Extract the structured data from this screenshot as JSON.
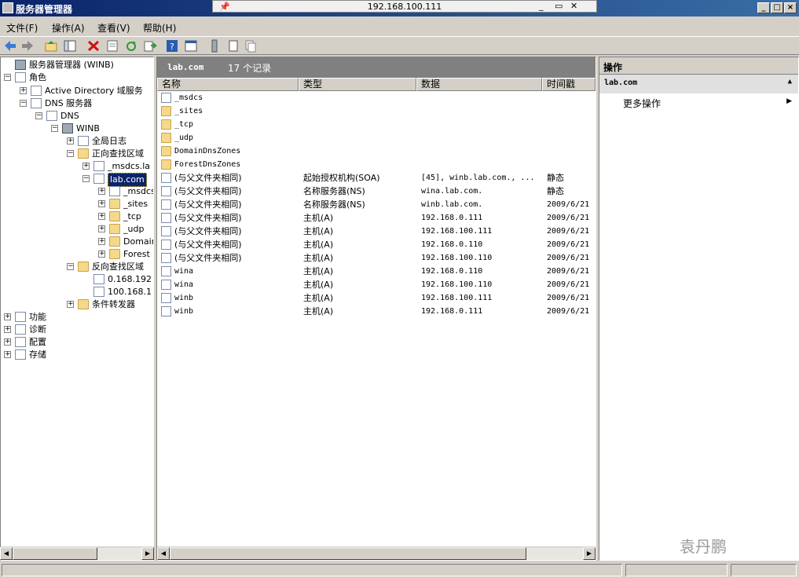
{
  "window": {
    "title": "服务器管理器",
    "rdp_ip": "192.168.100.111",
    "rdp_controls": "_ ▭ ✕"
  },
  "menu": [
    "文件(F)",
    "操作(A)",
    "查看(V)",
    "帮助(H)"
  ],
  "tree": [
    {
      "label": "服务器管理器 (WINB)",
      "depth": 0,
      "exp": "",
      "icon": "server-manager-icon"
    },
    {
      "label": "角色",
      "depth": 0,
      "exp": "−",
      "icon": "roles-icon"
    },
    {
      "label": "Active Directory 域服务",
      "depth": 1,
      "exp": "+",
      "icon": "ad-icon"
    },
    {
      "label": "DNS 服务器",
      "depth": 1,
      "exp": "−",
      "icon": "dns-server-icon"
    },
    {
      "label": "DNS",
      "depth": 2,
      "exp": "−",
      "icon": "dns-icon"
    },
    {
      "label": "WINB",
      "depth": 3,
      "exp": "−",
      "icon": "server-icon"
    },
    {
      "label": "全局日志",
      "depth": 4,
      "exp": "+",
      "icon": "log-icon"
    },
    {
      "label": "正向查找区域",
      "depth": 4,
      "exp": "−",
      "icon": "folder-icon"
    },
    {
      "label": "_msdcs.la",
      "depth": 5,
      "exp": "+",
      "icon": "zone-icon"
    },
    {
      "label": "lab.com",
      "depth": 5,
      "exp": "−",
      "icon": "zone-icon",
      "selected": true
    },
    {
      "label": "_msdcs",
      "depth": 6,
      "exp": "+",
      "icon": "zone-icon"
    },
    {
      "label": "_sites",
      "depth": 6,
      "exp": "+",
      "icon": "folder-icon"
    },
    {
      "label": "_tcp",
      "depth": 6,
      "exp": "+",
      "icon": "folder-icon"
    },
    {
      "label": "_udp",
      "depth": 6,
      "exp": "+",
      "icon": "folder-icon"
    },
    {
      "label": "Domain",
      "depth": 6,
      "exp": "+",
      "icon": "folder-icon"
    },
    {
      "label": "Forest",
      "depth": 6,
      "exp": "+",
      "icon": "folder-icon"
    },
    {
      "label": "反向查找区域",
      "depth": 4,
      "exp": "−",
      "icon": "folder-icon"
    },
    {
      "label": "0.168.192",
      "depth": 5,
      "exp": "",
      "icon": "zone-icon"
    },
    {
      "label": "100.168.1",
      "depth": 5,
      "exp": "",
      "icon": "zone-icon"
    },
    {
      "label": "条件转发器",
      "depth": 4,
      "exp": "+",
      "icon": "folder-icon"
    },
    {
      "label": "功能",
      "depth": 0,
      "exp": "+",
      "icon": "features-icon"
    },
    {
      "label": "诊断",
      "depth": 0,
      "exp": "+",
      "icon": "diagnostics-icon"
    },
    {
      "label": "配置",
      "depth": 0,
      "exp": "+",
      "icon": "configuration-icon"
    },
    {
      "label": "存储",
      "depth": 0,
      "exp": "+",
      "icon": "storage-icon"
    }
  ],
  "list": {
    "title": "lab.com",
    "count": "17 个记录",
    "columns": [
      "名称",
      "类型",
      "数据",
      "时间戳"
    ],
    "rows": [
      {
        "name": "_msdcs",
        "type": "",
        "data": "",
        "ts": "",
        "icon": "zone-icon"
      },
      {
        "name": "_sites",
        "type": "",
        "data": "",
        "ts": "",
        "icon": "folder-icon"
      },
      {
        "name": "_tcp",
        "type": "",
        "data": "",
        "ts": "",
        "icon": "folder-icon"
      },
      {
        "name": "_udp",
        "type": "",
        "data": "",
        "ts": "",
        "icon": "folder-icon"
      },
      {
        "name": "DomainDnsZones",
        "type": "",
        "data": "",
        "ts": "",
        "icon": "folder-icon"
      },
      {
        "name": "ForestDnsZones",
        "type": "",
        "data": "",
        "ts": "",
        "icon": "folder-icon"
      },
      {
        "name": "(与父文件夹相同)",
        "type": "起始授权机构(SOA)",
        "data": "[45], winb.lab.com., ...",
        "ts": "静态",
        "icon": "record-icon"
      },
      {
        "name": "(与父文件夹相同)",
        "type": "名称服务器(NS)",
        "data": "wina.lab.com.",
        "ts": "静态",
        "icon": "record-icon"
      },
      {
        "name": "(与父文件夹相同)",
        "type": "名称服务器(NS)",
        "data": "winb.lab.com.",
        "ts": "2009/6/21",
        "icon": "record-icon"
      },
      {
        "name": "(与父文件夹相同)",
        "type": "主机(A)",
        "data": "192.168.0.111",
        "ts": "2009/6/21",
        "icon": "record-icon"
      },
      {
        "name": "(与父文件夹相同)",
        "type": "主机(A)",
        "data": "192.168.100.111",
        "ts": "2009/6/21",
        "icon": "record-icon"
      },
      {
        "name": "(与父文件夹相同)",
        "type": "主机(A)",
        "data": "192.168.0.110",
        "ts": "2009/6/21",
        "icon": "record-icon"
      },
      {
        "name": "(与父文件夹相同)",
        "type": "主机(A)",
        "data": "192.168.100.110",
        "ts": "2009/6/21",
        "icon": "record-icon"
      },
      {
        "name": "wina",
        "type": "主机(A)",
        "data": "192.168.0.110",
        "ts": "2009/6/21",
        "icon": "record-icon"
      },
      {
        "name": "wina",
        "type": "主机(A)",
        "data": "192.168.100.110",
        "ts": "2009/6/21",
        "icon": "record-icon"
      },
      {
        "name": "winb",
        "type": "主机(A)",
        "data": "192.168.100.111",
        "ts": "2009/6/21",
        "icon": "record-icon"
      },
      {
        "name": "winb",
        "type": "主机(A)",
        "data": "192.168.0.111",
        "ts": "2009/6/21",
        "icon": "record-icon"
      }
    ]
  },
  "actions": {
    "header": "操作",
    "sub": "lab.com",
    "more": "更多操作"
  },
  "watermark": "袁丹鹏"
}
